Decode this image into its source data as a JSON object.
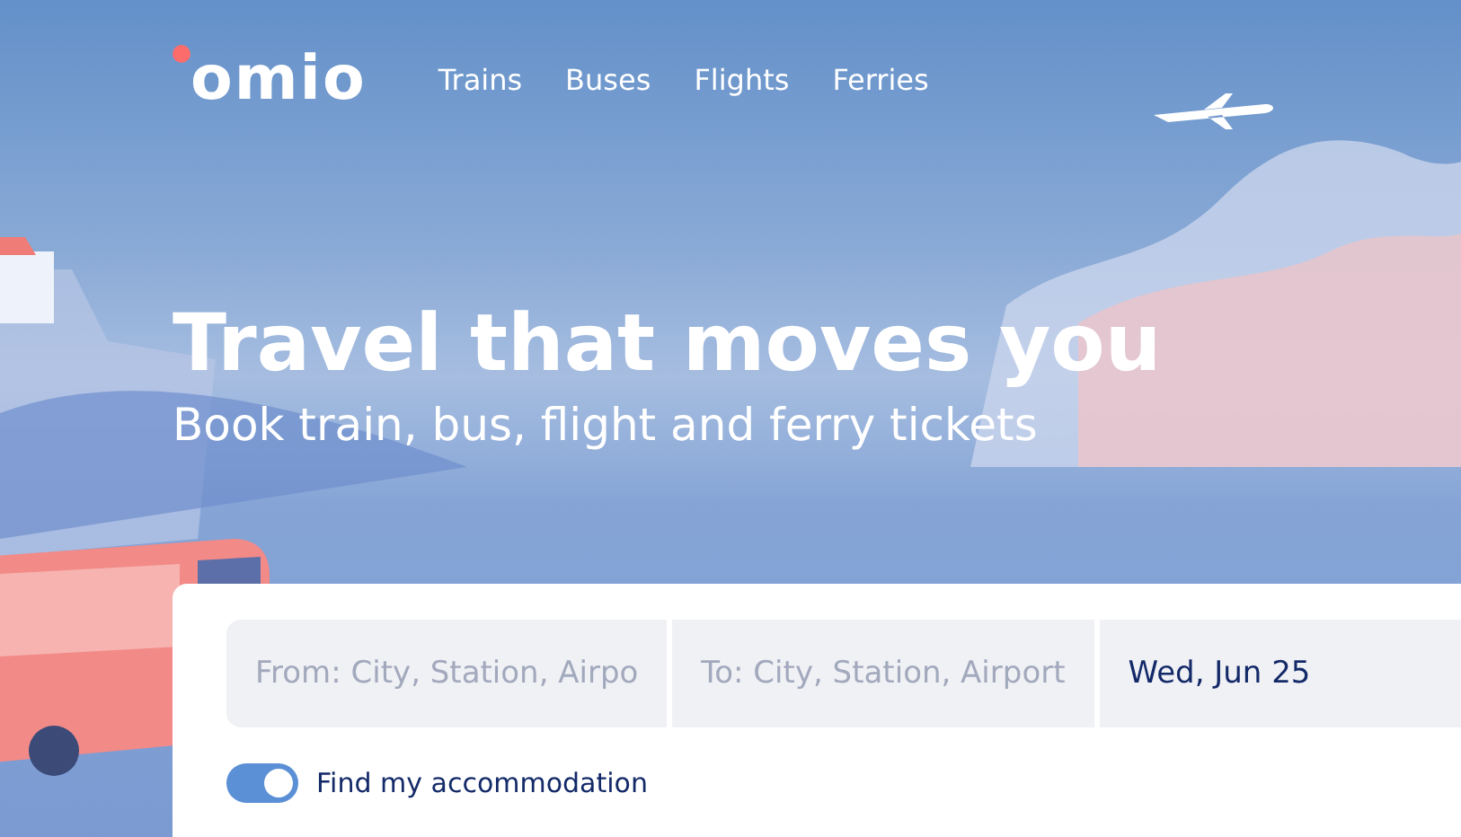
{
  "logo": {
    "text": "omio"
  },
  "nav": [
    {
      "label": "Trains"
    },
    {
      "label": "Buses"
    },
    {
      "label": "Flights"
    },
    {
      "label": "Ferries"
    }
  ],
  "hero": {
    "title": "Travel that moves you",
    "subtitle": "Book train, bus, flight and ferry tickets"
  },
  "search": {
    "fields": [
      {
        "kind": "placeholder",
        "text": "From: City, Station, Airpo"
      },
      {
        "kind": "placeholder",
        "text": "To: City, Station, Airport"
      },
      {
        "kind": "value",
        "text": "Wed, Jun 25"
      }
    ],
    "accommodation_toggle": {
      "label": "Find my accommodation",
      "on": true
    }
  }
}
